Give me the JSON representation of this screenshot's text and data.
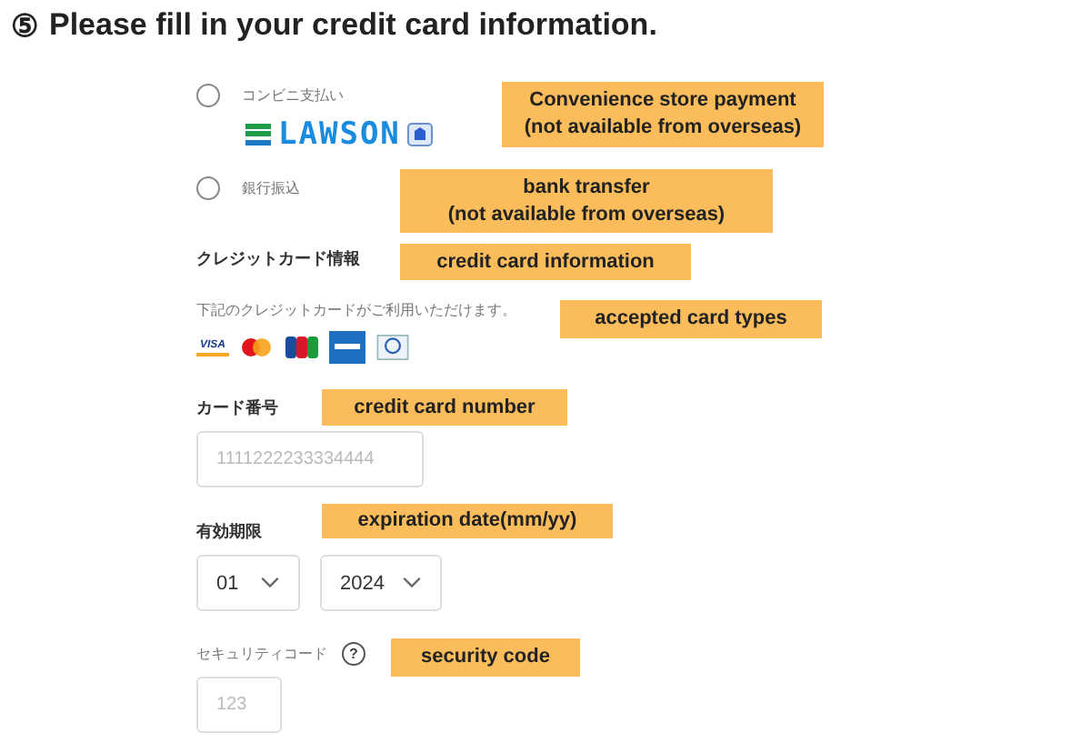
{
  "heading": {
    "number": "⑤",
    "text": "Please fill in your credit card information."
  },
  "payment_options": [
    {
      "label": "コンビニ支払い",
      "selected": false,
      "logo": "LAWSON"
    },
    {
      "label": "銀行振込",
      "selected": false
    }
  ],
  "credit_card": {
    "title": "クレジットカード情報",
    "note": "下記のクレジットカードがご利用いただけます。",
    "brands": [
      {
        "kind": "visa",
        "label": "VISA"
      },
      {
        "kind": "mastercard"
      },
      {
        "kind": "jcb"
      },
      {
        "kind": "amex"
      },
      {
        "kind": "diners"
      }
    ],
    "number": {
      "label": "カード番号",
      "placeholder": "1111222233334444"
    },
    "expiry": {
      "label": "有効期限",
      "month": "01",
      "year": "2024"
    },
    "security": {
      "label": "セキュリティコード",
      "help": "?",
      "placeholder": "123"
    }
  },
  "callouts": [
    {
      "lines": [
        "Convenience store payment",
        "(not available from overseas)"
      ]
    },
    {
      "lines": [
        "bank transfer",
        "(not available from overseas)"
      ]
    },
    {
      "lines": [
        "credit card information"
      ]
    },
    {
      "lines": [
        "accepted card types"
      ]
    },
    {
      "lines": [
        "credit card number"
      ]
    },
    {
      "lines": [
        "expiration date(mm/yy)"
      ]
    },
    {
      "lines": [
        "security code"
      ]
    }
  ]
}
